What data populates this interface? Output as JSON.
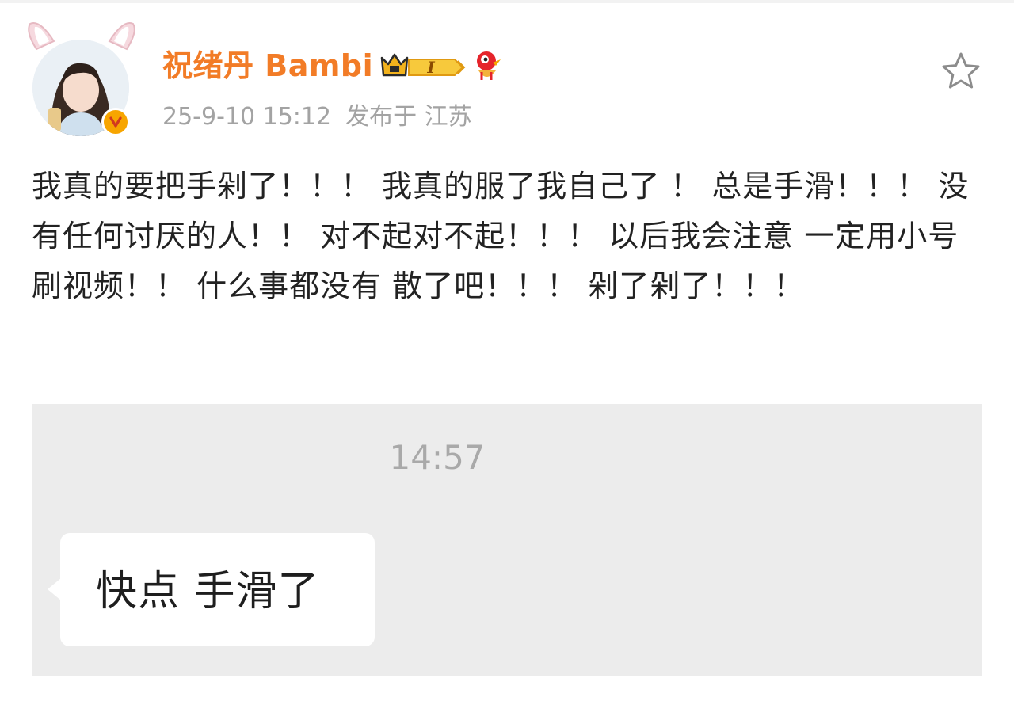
{
  "post": {
    "author": {
      "name": "祝绪丹 Bambi",
      "avatar": "avatar-photo",
      "verified_icon": "verified-v-icon",
      "badges": [
        "crown-level-badge",
        "mascot-badge"
      ],
      "level_label": "I"
    },
    "meta": {
      "time": "25-9-10 15:12",
      "location": "发布于 江苏"
    },
    "actions": {
      "favorite_icon": "star-outline-icon"
    },
    "text": "我真的要把手剁了！！！ 我真的服了我自己了 ！ 总是手滑！！！ 没有任何讨厌的人！！ 对不起对不起！！！ 以后我会注意 一定用小号刷视频！！ 什么事都没有 散了吧！！！ 剁了剁了！！！",
    "image": {
      "chat_time": "14:57",
      "bubble_text": "快点 手滑了"
    }
  },
  "colors": {
    "username": "#f27c27",
    "meta": "#a3a3a3",
    "text": "#222222",
    "image_bg": "#ececec",
    "verified": "#f7a500"
  }
}
